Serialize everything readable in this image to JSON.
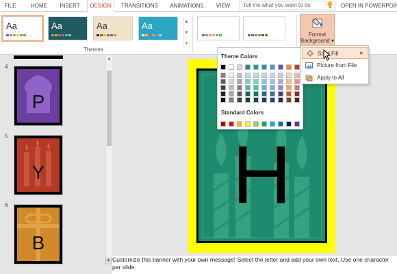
{
  "ribbon_tabs": [
    {
      "label": "FILE"
    },
    {
      "label": "HOME"
    },
    {
      "label": "INSERT"
    },
    {
      "label": "DESIGN"
    },
    {
      "label": "TRANSITIONS"
    },
    {
      "label": "ANIMATIONS"
    },
    {
      "label": "VIEW"
    }
  ],
  "active_tab": "DESIGN",
  "tell_me": {
    "placeholder": "Tell me what you want to do"
  },
  "open_in": "OPEN IN POWERPOIN",
  "themes": {
    "group_label": "Themes",
    "items": [
      {
        "sample": "Aa",
        "bg": "#ffffff",
        "fg": "#333333",
        "swatches": [
          "#4472c4",
          "#ed7d31",
          "#a5a5a5",
          "#ffc000",
          "#5b9bd5",
          "#70ad47"
        ]
      },
      {
        "sample": "Aa",
        "bg": "#1f5b5f",
        "fg": "#ffffff",
        "swatches": [
          "#7fb3a8",
          "#e0a64b",
          "#cf6a51",
          "#9c7ab8",
          "#6ea3c5",
          "#b9c96a"
        ]
      },
      {
        "sample": "Aa",
        "bg": "#f0e3c8",
        "fg": "#333333",
        "swatches": [
          "#3b2b1f",
          "#b84a34",
          "#e9b44c",
          "#5b7d6e",
          "#7e6b8f",
          "#9c8d6c"
        ]
      },
      {
        "sample": "Aa",
        "bg": "#2aa6c3",
        "fg": "#ffffff",
        "swatches": [
          "#ffffff",
          "#f4c242",
          "#e05f3b",
          "#7cc26c",
          "#a57cc3",
          "#d0d0d0"
        ]
      }
    ],
    "variants": [
      {
        "swatches": [
          "#4472c4",
          "#ed7d31",
          "#a5a5a5",
          "#ffc000",
          "#5b9bd5",
          "#70ad47"
        ]
      },
      {
        "swatches": [
          "#2e75b6",
          "#c55a11",
          "#7f7f7f",
          "#bf9000",
          "#2f5597",
          "#548235"
        ]
      }
    ]
  },
  "format_background": {
    "line1": "Format",
    "line2": "Background",
    "caret": "▾"
  },
  "color_menu": {
    "theme_colors_label": "Theme Colors",
    "standard_colors_label": "Standard Colors",
    "theme_top": [
      "#000000",
      "#ffffff",
      "#d9d9d9",
      "#1f8a6e",
      "#17a38c",
      "#2b8db5",
      "#5b8fd6",
      "#6b4fa8",
      "#f28a2d",
      "#c0392b"
    ],
    "theme_shades": [
      [
        "#7f7f7f",
        "#f2f2f2",
        "#bfbfbf",
        "#b2e3d5",
        "#a8e6d9",
        "#b3dcec",
        "#c5d8f3",
        "#d3c8ec",
        "#fbd8b7",
        "#f1b8b0"
      ],
      [
        "#595959",
        "#d9d9d9",
        "#a6a6a6",
        "#7fd0b8",
        "#74d7c3",
        "#85c8e0",
        "#a3c1ea",
        "#b7a6de",
        "#f7bf8f",
        "#e89589"
      ],
      [
        "#404040",
        "#bfbfbf",
        "#808080",
        "#4bbd9c",
        "#3fc7ac",
        "#57b4d5",
        "#80aae2",
        "#9b84d1",
        "#f4a568",
        "#df7162"
      ],
      [
        "#262626",
        "#a6a6a6",
        "#595959",
        "#17674f",
        "#117a67",
        "#1f6a88",
        "#3a6aa8",
        "#4f3b7e",
        "#b5671f",
        "#902b20"
      ],
      [
        "#0d0d0d",
        "#808080",
        "#404040",
        "#0f4535",
        "#0b5145",
        "#15475b",
        "#264670",
        "#352754",
        "#794515",
        "#601c15"
      ]
    ],
    "standard": [
      "#c00000",
      "#ff0000",
      "#ffc000",
      "#ffff00",
      "#92d050",
      "#00b050",
      "#00b0f0",
      "#0070c0",
      "#002060",
      "#7030a0"
    ]
  },
  "fill_menu": {
    "items": [
      {
        "label": "Solid Fill",
        "hovered": true,
        "has_submenu": true,
        "icon": "paint-bucket-icon"
      },
      {
        "label": "Picture from File",
        "hovered": false,
        "has_submenu": false,
        "icon": "picture-icon"
      },
      {
        "label": "Apply to All",
        "hovered": false,
        "has_submenu": false,
        "icon": "apply-all-icon"
      }
    ]
  },
  "thumbnails": [
    {
      "number": "4",
      "letter": "P",
      "bg": "#6a3fa0"
    },
    {
      "number": "5",
      "letter": "Y",
      "bg": "#b43a25"
    },
    {
      "number": "6",
      "letter": "B",
      "bg": "#d08a2b"
    }
  ],
  "slide": {
    "letter": "H",
    "border_color": "#ffff00",
    "card_color": "#1e8a6e"
  },
  "notes": {
    "text": "Customize this banner with your own message! Select the letter and add your own text. Use one character per slide."
  }
}
